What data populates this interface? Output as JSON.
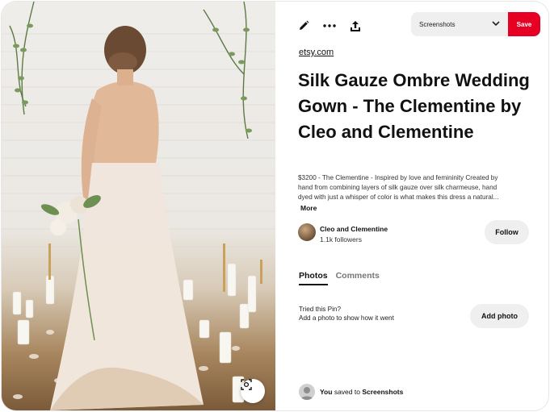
{
  "toolbar": {
    "edit_icon": "pencil-icon",
    "more_icon": "ellipsis-icon",
    "share_icon": "share-upload-icon"
  },
  "board_select": {
    "selected": "Screenshots"
  },
  "save_button": {
    "label": "Save",
    "color": "#e60023"
  },
  "source_link": "etsy.com",
  "pin": {
    "title": "Silk Gauze Ombre Wedding Gown - The Clementine by Cleo and Clementine",
    "description_lines": [
      "$3200 - The Clementine - Inspired by love and femininity Created by",
      "hand from combining layers of silk gauze over silk charmeuse, hand",
      "dyed with just a whisper of color is what makes this dress a natural..."
    ],
    "more_label": "More"
  },
  "creator": {
    "name": "Cleo and Clementine",
    "followers": "1.1k followers",
    "follow_label": "Follow"
  },
  "tabs": [
    {
      "label": "Photos",
      "active": true
    },
    {
      "label": "Comments",
      "active": false
    }
  ],
  "tried": {
    "heading": "Tried this Pin?",
    "subtext": "Add a photo to show how it went",
    "button_label": "Add photo"
  },
  "saved": {
    "you": "You",
    "middle": "saved to",
    "board": "Screenshots"
  },
  "photo": {
    "lens_icon": "visual-search-icon"
  }
}
